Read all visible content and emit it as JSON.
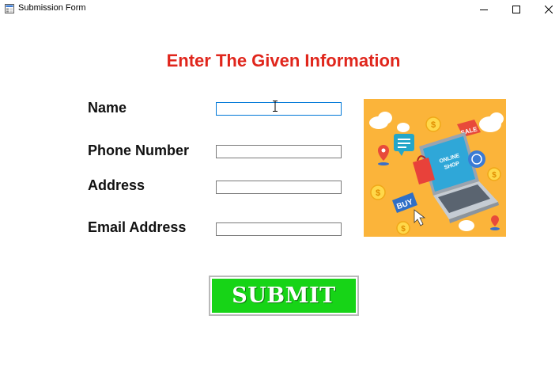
{
  "window": {
    "title": "Submission Form",
    "controls": [
      "minimize",
      "maximize",
      "close"
    ]
  },
  "form": {
    "heading": "Enter The Given Information",
    "fields": [
      {
        "label": "Name",
        "value": "",
        "focused": true
      },
      {
        "label": "Phone Number",
        "value": ""
      },
      {
        "label": "Address",
        "value": ""
      },
      {
        "label": "Email Address",
        "value": ""
      }
    ],
    "submit_label": "SUBMIT"
  },
  "image": {
    "bag_text": "ONLINE SHOP",
    "sale_tag": "SALE",
    "buy_tag": "BUY",
    "coin_symbol": "$"
  },
  "colors": {
    "heading": "#e0261c",
    "submit_bg": "#17d417",
    "image_bg": "#fbb43a",
    "focus_border": "#0078d7"
  }
}
